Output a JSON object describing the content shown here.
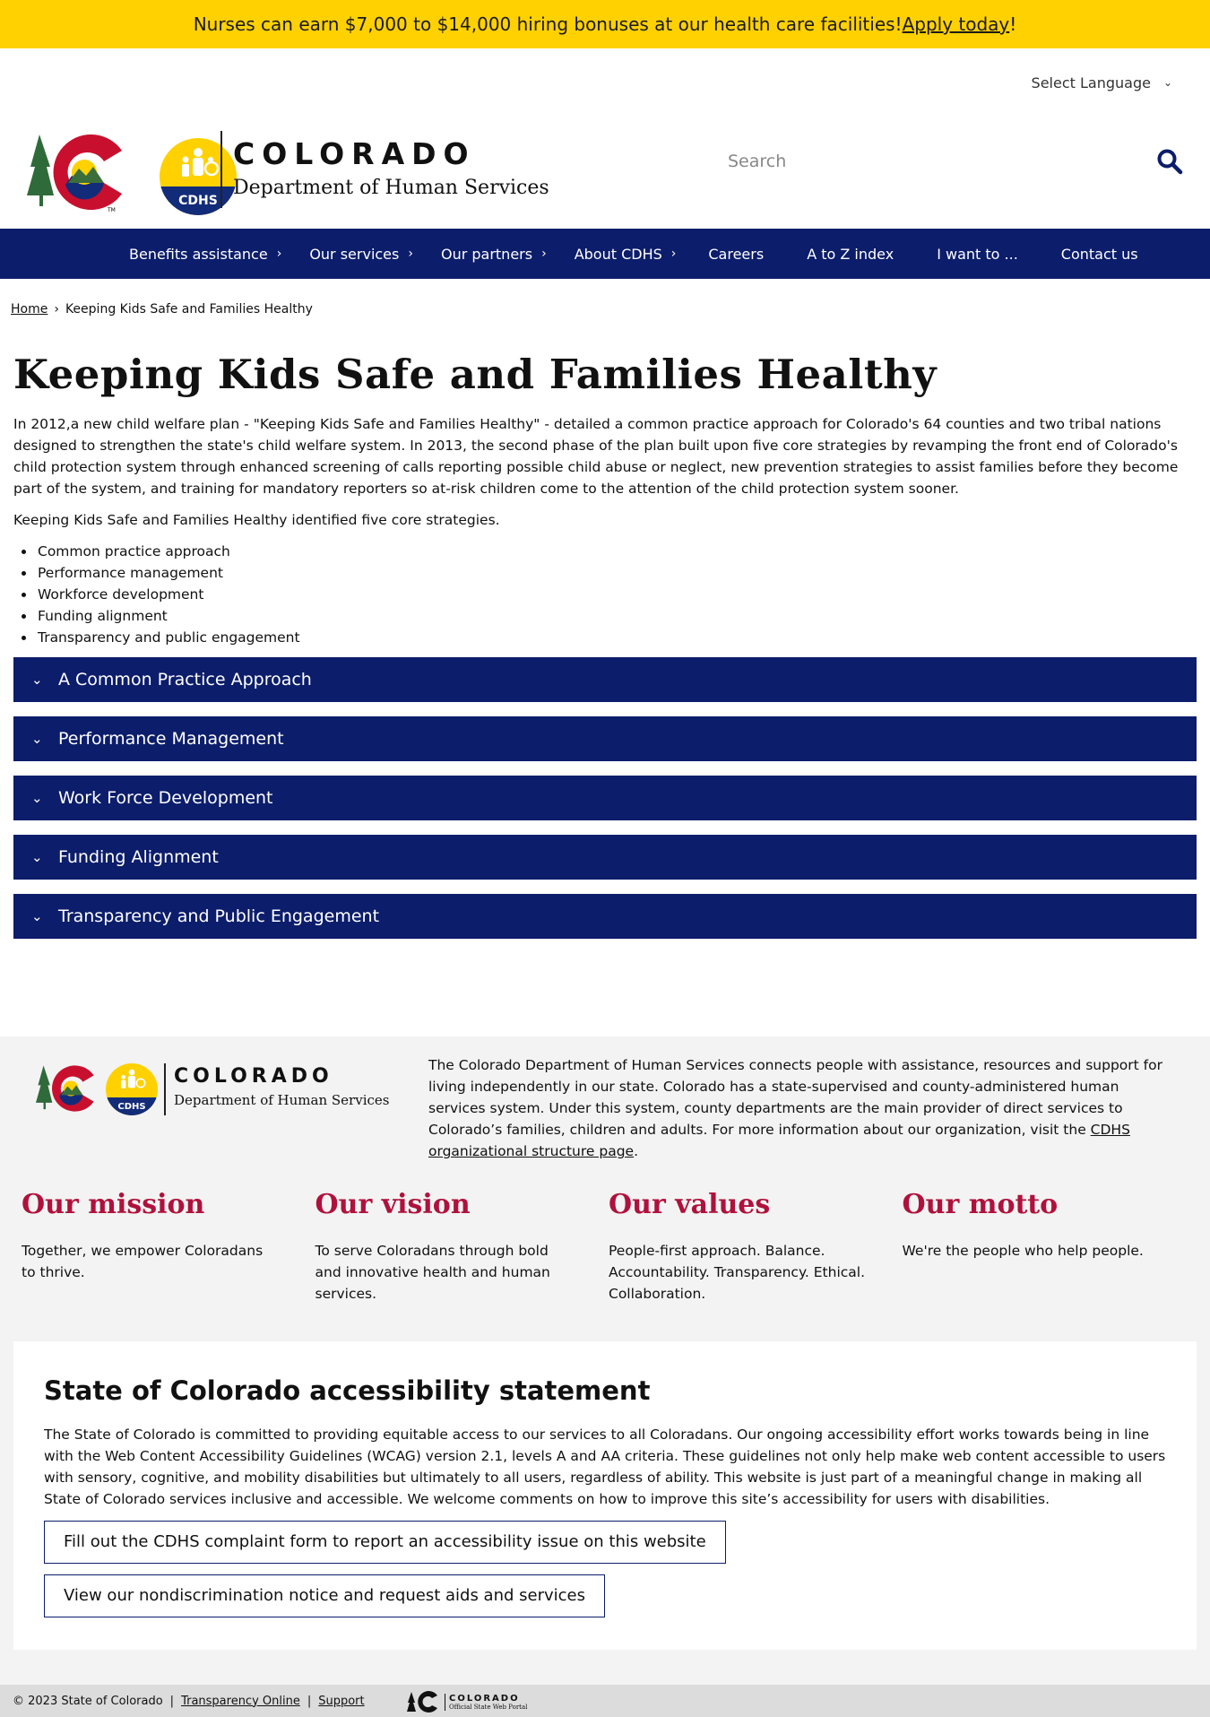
{
  "alert": {
    "text_before": "Nurses can earn $7,000 to $14,000 hiring bonuses at our health care facilities! ",
    "link": "Apply today",
    "text_after": "!"
  },
  "language": {
    "label": "Select Language"
  },
  "brand": {
    "state": "COLORADO",
    "department": "Department of Human Services",
    "seal_text": "CDHS"
  },
  "search": {
    "placeholder": "Search"
  },
  "nav": {
    "items": [
      {
        "label": "Benefits assistance"
      },
      {
        "label": "Our services"
      },
      {
        "label": "Our partners"
      },
      {
        "label": "About CDHS"
      },
      {
        "label": "Careers"
      },
      {
        "label": "A to Z index"
      },
      {
        "label": "I want to ..."
      },
      {
        "label": "Contact us"
      }
    ]
  },
  "breadcrumb": {
    "home": "Home",
    "current": "Keeping Kids Safe and Families Healthy"
  },
  "page": {
    "title": "Keeping Kids Safe and Families Healthy",
    "intro": "In 2012,a new child welfare plan - \"Keeping Kids Safe and Families Healthy\" - detailed a common practice approach for Colorado's 64 counties and two tribal nations designed to strengthen the state's child welfare system. In 2013, the second phase of the plan built upon five core strategies by revamping the front end of Colorado's child protection system through enhanced screening of calls reporting possible child abuse or neglect, new prevention strategies to assist families before they become part of the system, and training for mandatory reporters so at-risk children come to the attention of the child protection system sooner.",
    "strategies_lead": "Keeping Kids Safe and Families Healthy identified five core strategies.",
    "strategies": [
      "Common practice approach",
      "Performance management",
      "Workforce development",
      "Funding alignment",
      "Transparency and public engagement"
    ],
    "accordions": [
      "A Common Practice Approach",
      "Performance Management",
      "Work Force Development",
      "Funding Alignment",
      "Transparency and Public Engagement"
    ]
  },
  "footer": {
    "about_text": "The Colorado Department of Human Services connects people with assistance, resources and support for living independently in our state. Colorado has a state-supervised and county-administered human services system. Under this system, county departments are the main provider of direct services to Colorado’s families, children and adults. For more information about our organization, visit the ",
    "about_link": "CDHS organizational structure page",
    "about_end": ".",
    "columns": [
      {
        "heading": "Our mission",
        "text": "Together, we empower Coloradans to thrive."
      },
      {
        "heading": "Our vision",
        "text": "To serve Coloradans through bold and innovative health and human services."
      },
      {
        "heading": "Our values",
        "text": "People-first approach. Balance. Accountability. Transparency. Ethical. Collaboration."
      },
      {
        "heading": "Our motto",
        "text": "We're the people who help people."
      }
    ],
    "accessibility": {
      "heading": "State of Colorado accessibility statement",
      "text": "The State of Colorado is committed to providing equitable access to our services to all Coloradans. Our ongoing accessibility effort works towards being in line with the Web Content Accessibility Guidelines (WCAG) version 2.1, levels A and AA criteria. These guidelines not only help make web content accessible to users with sensory, cognitive, and mobility disabilities but ultimately to all users, regardless of ability. This website is just part of a meaningful change in making all State of Colorado services inclusive and accessible. We welcome comments on how to improve this site’s accessibility for users with disabilities.",
      "button1": "Fill out the CDHS complaint form to report an accessibility issue on this website",
      "button2": "View our nondiscrimination notice and request aids and services"
    },
    "bottom": {
      "copyright": "© 2023 State of Colorado",
      "link1": "Transparency Online",
      "link2": "Support",
      "portal_state": "COLORADO",
      "portal_sub": "Official State Web Portal"
    }
  },
  "colors": {
    "alert_bg": "#ffd100",
    "nav_bg": "#0c1d6b",
    "footer_heading": "#b0113c",
    "footer_bg": "#f3f3f3"
  },
  "icons": {
    "search": "magnifier-icon",
    "chevron_right": "chevron-right-icon",
    "chevron_down": "chevron-down-icon"
  }
}
